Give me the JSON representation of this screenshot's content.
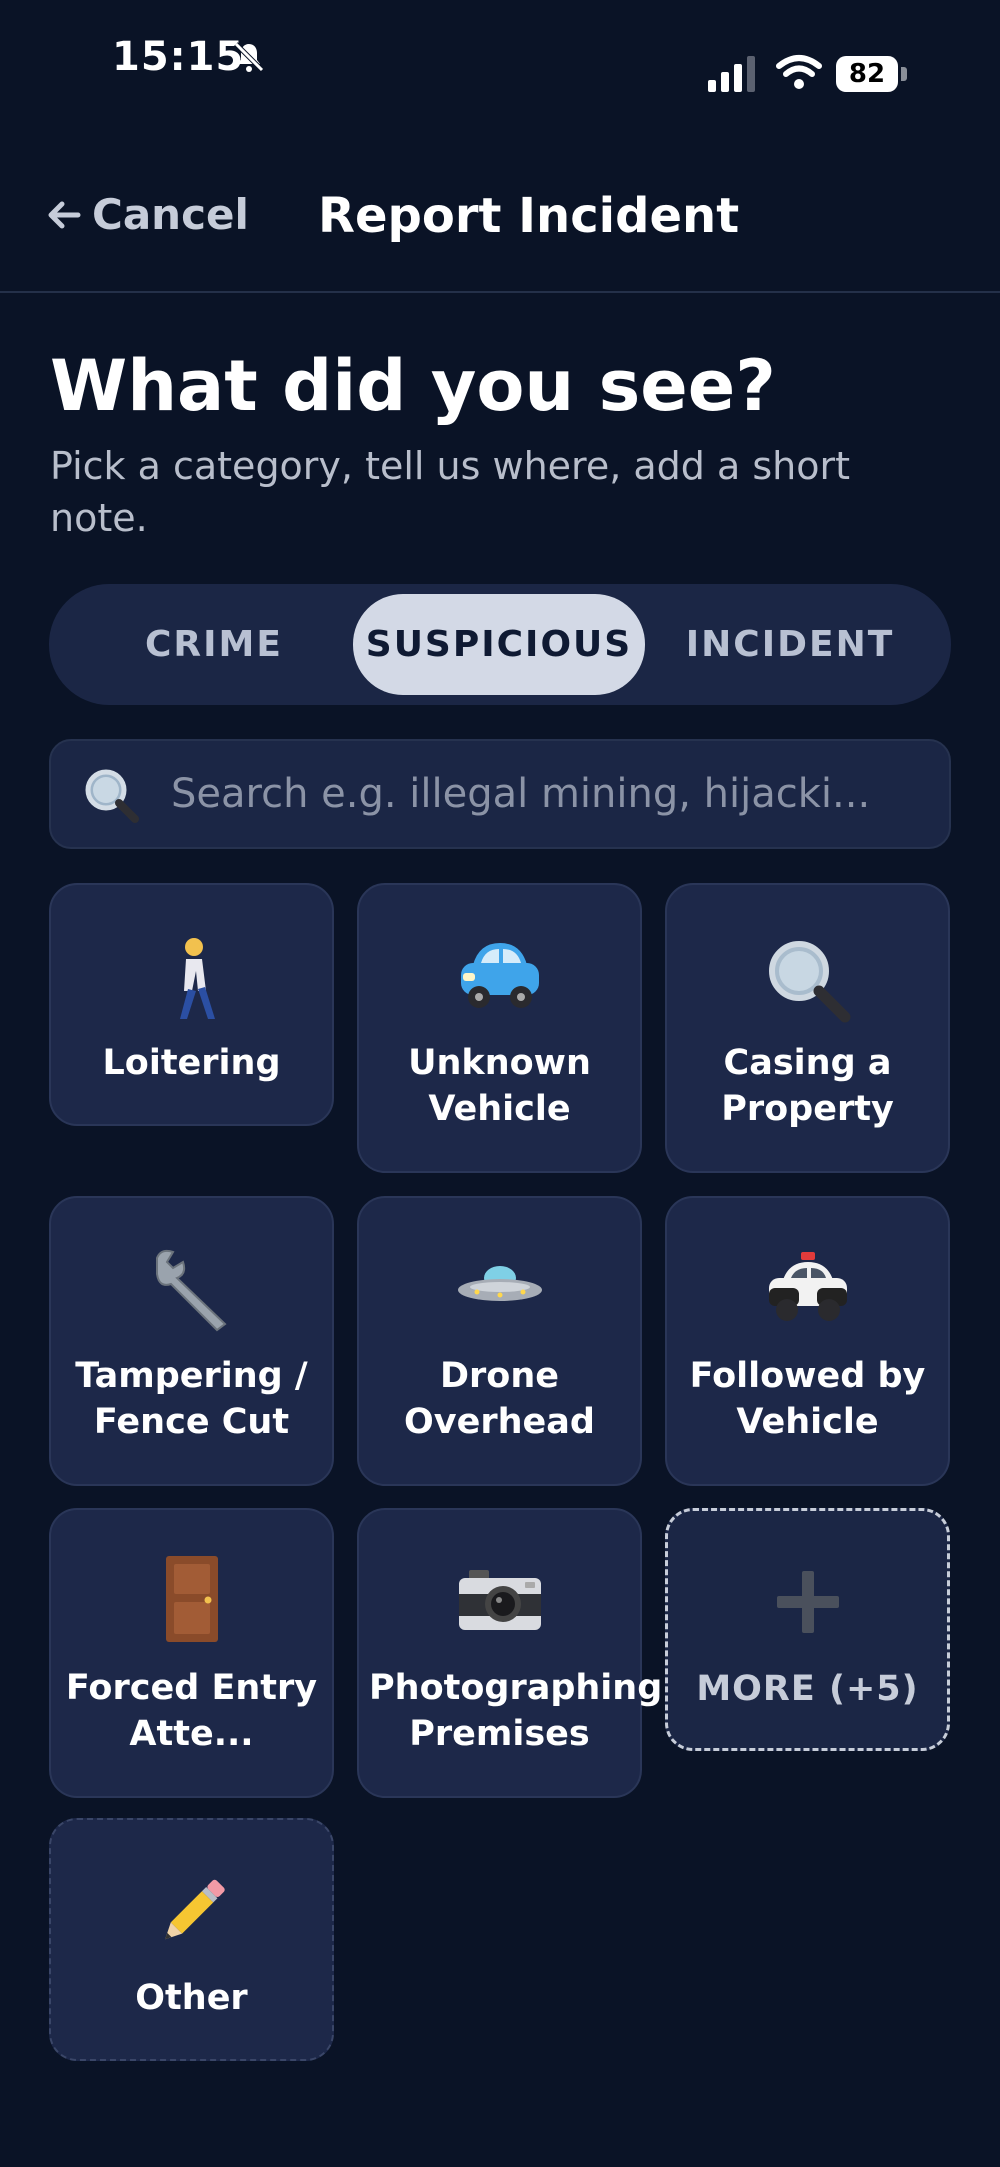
{
  "status": {
    "time": "15:15",
    "battery": "82"
  },
  "nav": {
    "cancel_label": "Cancel",
    "title": "Report Incident"
  },
  "page": {
    "heading": "What did you see?",
    "subheading": "Pick a category, tell us where, add a short note."
  },
  "tabs": [
    {
      "label": "CRIME"
    },
    {
      "label": "SUSPICIOUS",
      "selected": true
    },
    {
      "label": "INCIDENT"
    }
  ],
  "search": {
    "placeholder": "Search e.g. illegal mining, hijacki...",
    "icon": "magnifier-icon"
  },
  "categories": [
    {
      "label": "Loitering",
      "icon": "person-walking-icon"
    },
    {
      "label": "Unknown Vehicle",
      "icon": "car-icon"
    },
    {
      "label": "Casing a Property",
      "icon": "magnifier-icon"
    },
    {
      "label": "Tampering / Fence Cut",
      "icon": "wrench-icon"
    },
    {
      "label": "Drone Overhead",
      "icon": "ufo-icon"
    },
    {
      "label": "Followed by Vehicle",
      "icon": "police-car-icon"
    },
    {
      "label": "Forced Entry Atte...",
      "icon": "door-icon"
    },
    {
      "label": "Photographing Premises",
      "icon": "camera-icon"
    },
    {
      "label": "MORE (+5)",
      "icon": "plus-icon"
    },
    {
      "label": "Other",
      "icon": "pencil-icon"
    }
  ],
  "colors": {
    "background": "#0a1326",
    "card": "#1d2849",
    "selected_tab": "#d3d9e6"
  }
}
